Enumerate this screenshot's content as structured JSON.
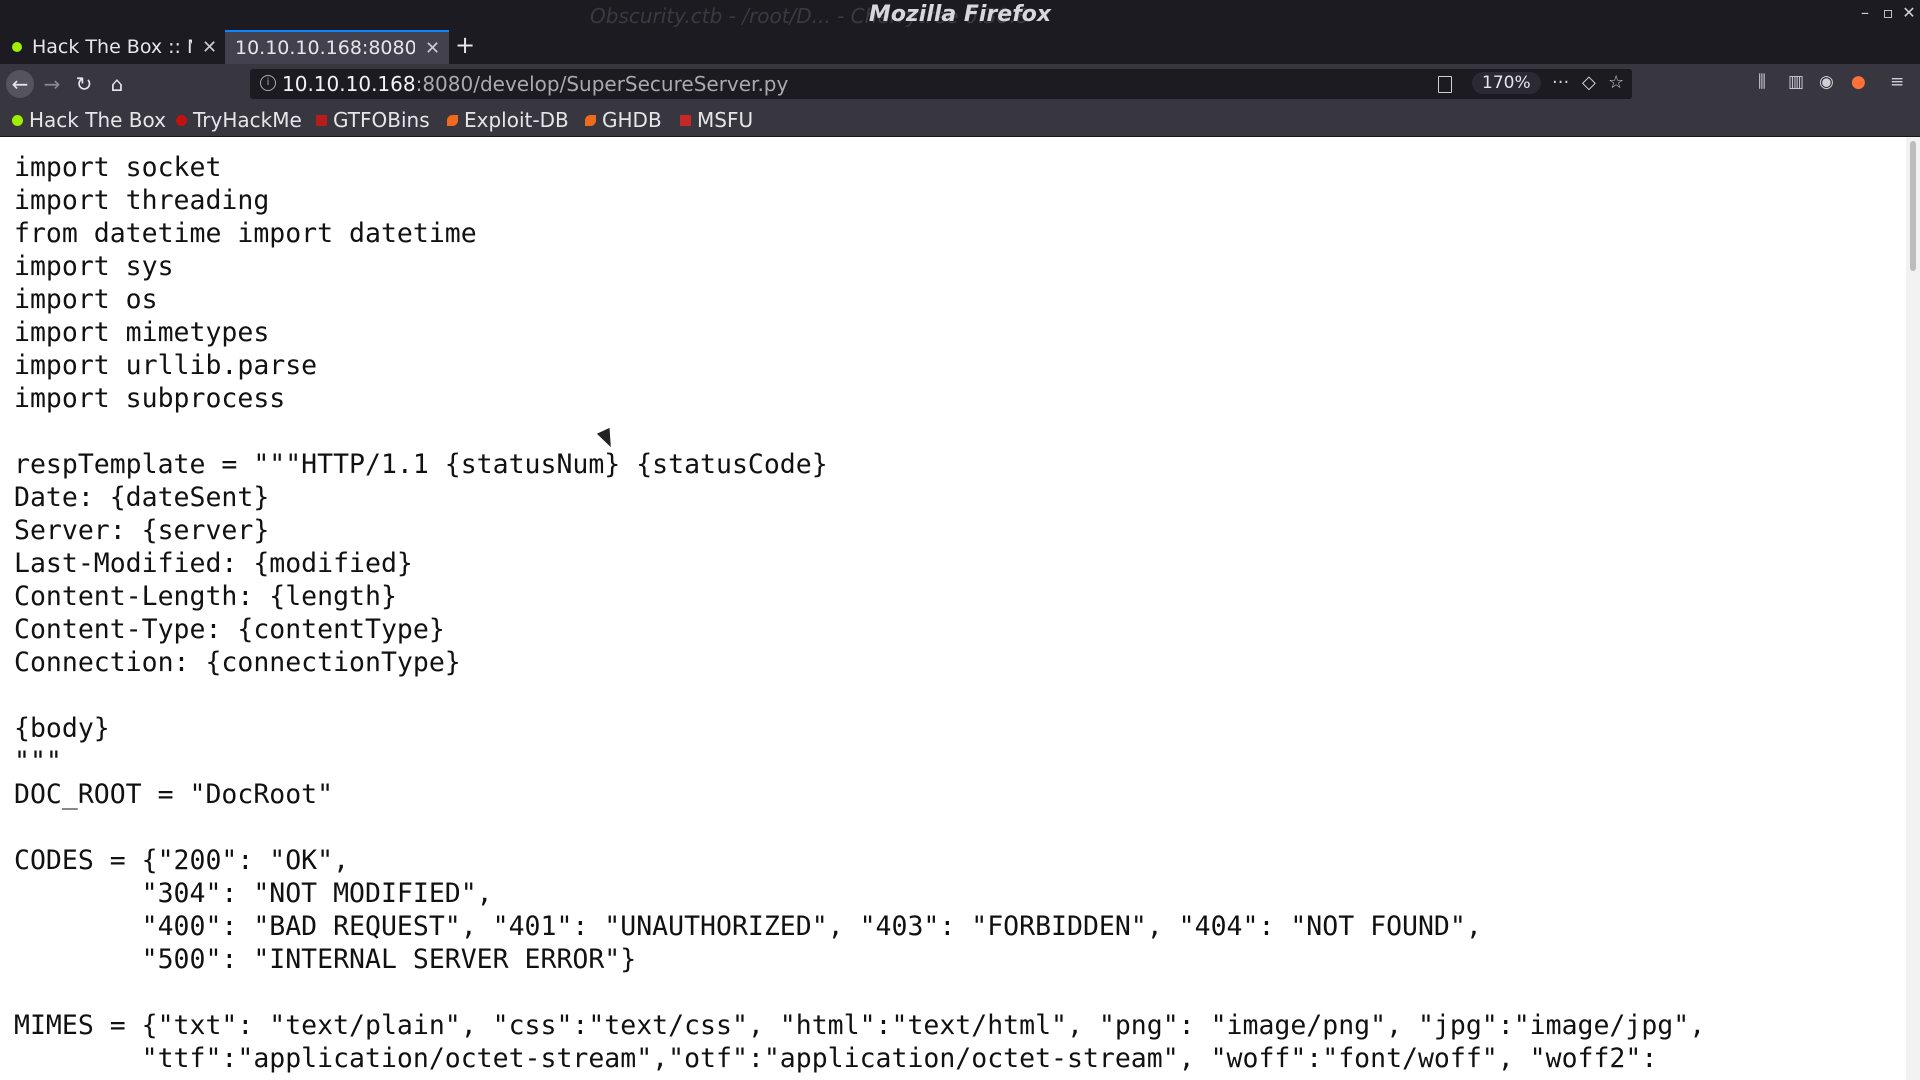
{
  "window": {
    "title": "Mozilla Firefox",
    "ghost_title": "Obscurity.ctb - /root/D... - Cherrytree 0.38.8",
    "controls": [
      "–",
      "▫",
      "✕"
    ]
  },
  "tabs": [
    {
      "label": "Hack The Box :: M",
      "active": false,
      "close": "✕"
    },
    {
      "label": "10.10.10.168:8080/",
      "active": true,
      "close": "✕"
    }
  ],
  "new_tab_label": "+",
  "nav": {
    "back": "←",
    "forward": "→",
    "reload": "↻",
    "home": "⌂"
  },
  "url": {
    "host": "10.10.10.168",
    "rest": ":8080/develop/SuperSecureServer.py",
    "zoom": "170%",
    "more": "···",
    "pocket": "◇",
    "star": "☆"
  },
  "toolbar_right": {
    "library": "⫼",
    "sidebar": "▥",
    "account": "◉",
    "extension": "●",
    "menu": "≡"
  },
  "bookmarks": [
    {
      "label": "Hack The Box",
      "icon": "htb-icon",
      "color": "#9fef00"
    },
    {
      "label": "TryHackMe",
      "icon": "thm-icon",
      "color": "#c11111"
    },
    {
      "label": "GTFOBins",
      "icon": "gtfobins-icon",
      "color": "#b71c1c"
    },
    {
      "label": "Exploit-DB",
      "icon": "exploitdb-icon",
      "color": "#f06a1d"
    },
    {
      "label": "GHDB",
      "icon": "ghdb-icon",
      "color": "#f06a1d"
    },
    {
      "label": "MSFU",
      "icon": "msfu-icon",
      "color": "#c62828"
    }
  ],
  "page": {
    "code_lines": [
      "import socket",
      "import threading",
      "from datetime import datetime",
      "import sys",
      "import os",
      "import mimetypes",
      "import urllib.parse",
      "import subprocess",
      "",
      "respTemplate = \"\"\"HTTP/1.1 {statusNum} {statusCode}",
      "Date: {dateSent}",
      "Server: {server}",
      "Last-Modified: {modified}",
      "Content-Length: {length}",
      "Content-Type: {contentType}",
      "Connection: {connectionType}",
      "",
      "{body}",
      "\"\"\"",
      "DOC_ROOT = \"DocRoot\"",
      "",
      "CODES = {\"200\": \"OK\",",
      "        \"304\": \"NOT MODIFIED\",",
      "        \"400\": \"BAD REQUEST\", \"401\": \"UNAUTHORIZED\", \"403\": \"FORBIDDEN\", \"404\": \"NOT FOUND\",",
      "        \"500\": \"INTERNAL SERVER ERROR\"}",
      "",
      "MIMES = {\"txt\": \"text/plain\", \"css\":\"text/css\", \"html\":\"text/html\", \"png\": \"image/png\", \"jpg\":\"image/jpg\",",
      "        \"ttf\":\"application/octet-stream\",\"otf\":\"application/octet-stream\", \"woff\":\"font/woff\", \"woff2\":"
    ]
  }
}
